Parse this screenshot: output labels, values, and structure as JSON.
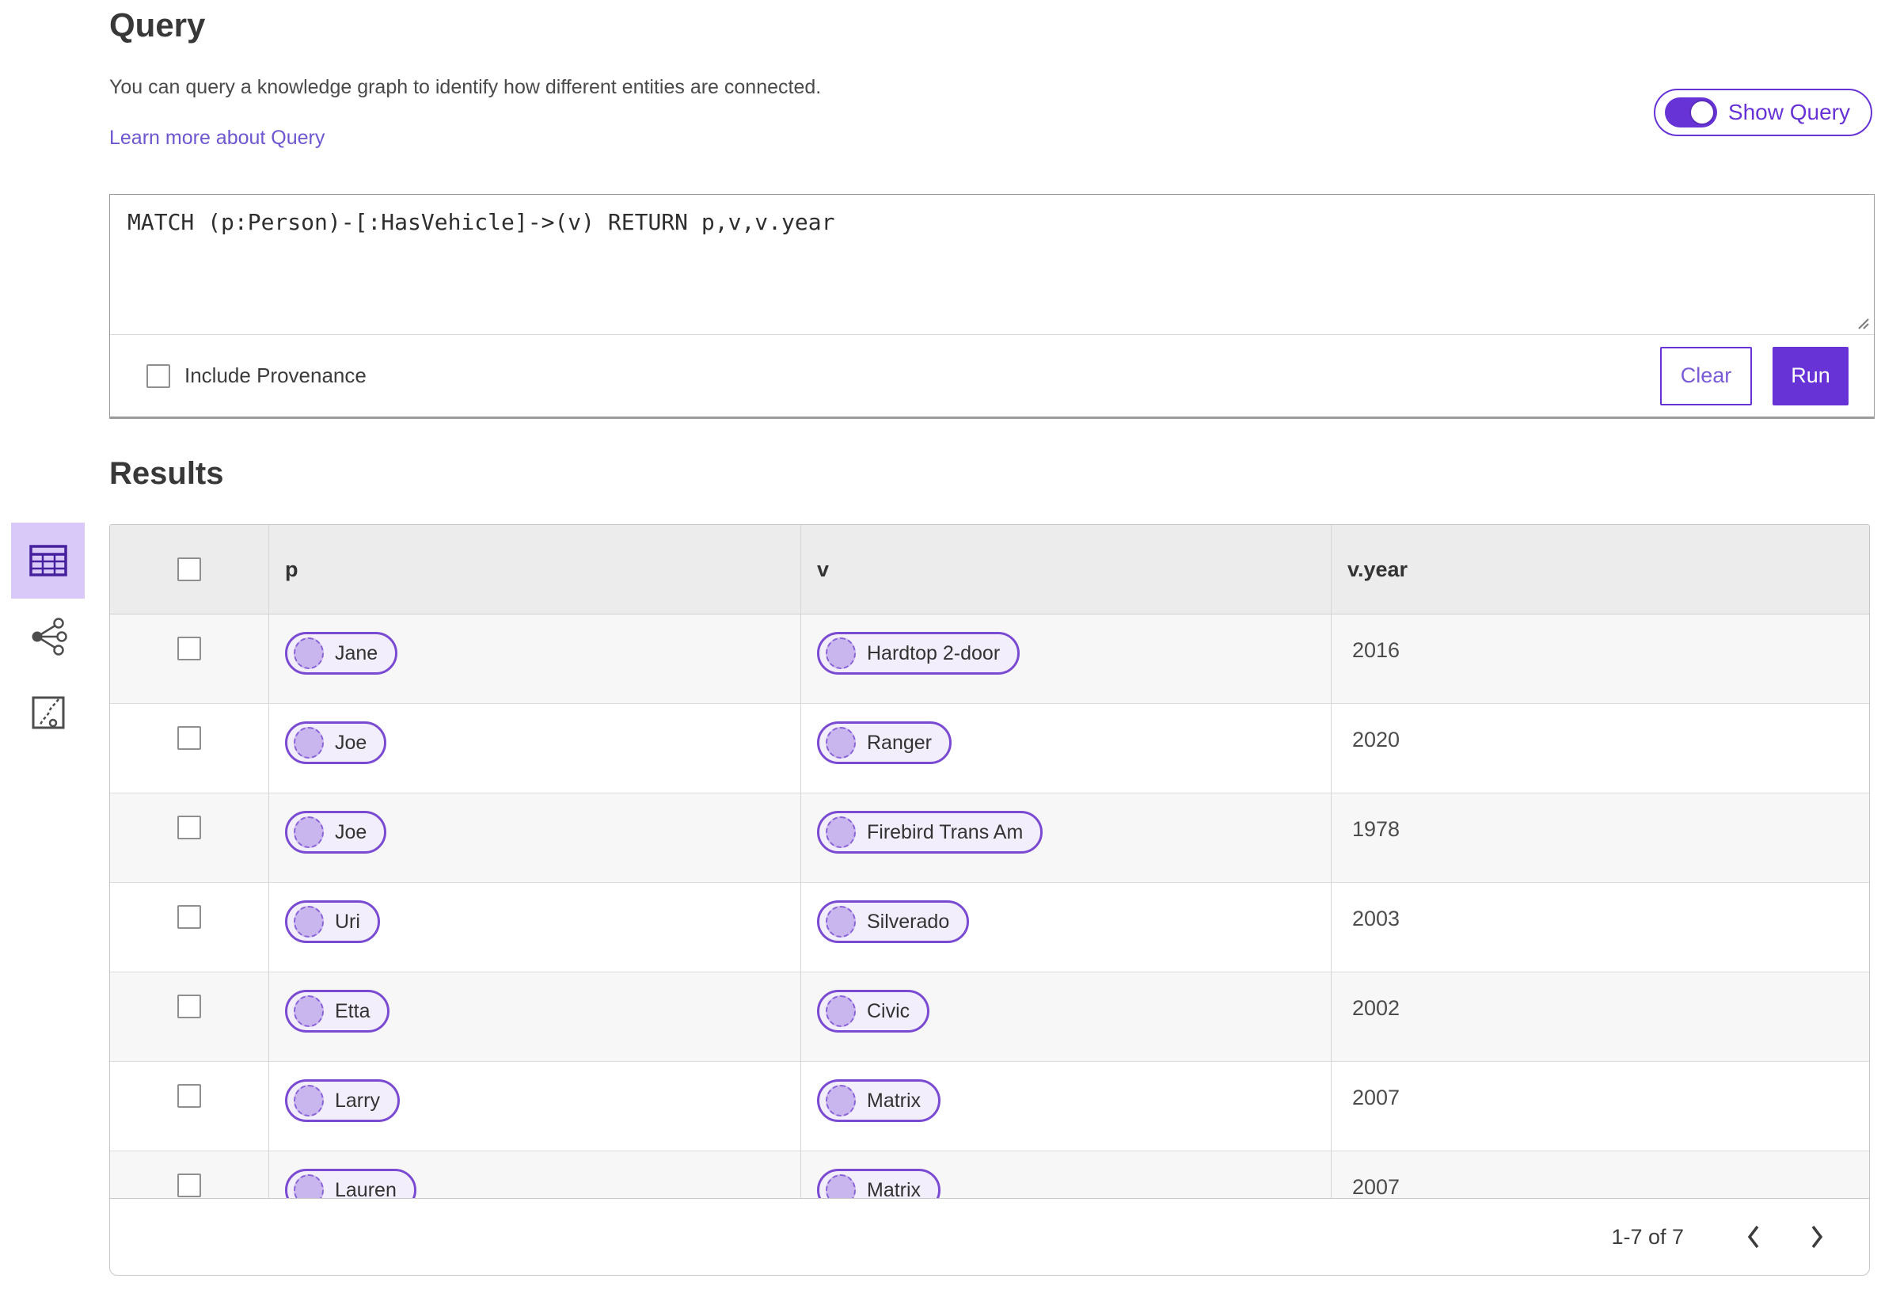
{
  "header": {
    "title": "Query",
    "description": "You can query a knowledge graph to identify how different entities are connected.",
    "learn_more": "Learn more about Query",
    "show_query_label": "Show Query",
    "show_query_on": true
  },
  "query_panel": {
    "query_text": "MATCH (p:Person)-[:HasVehicle]->(v) RETURN p,v,v.year",
    "include_provenance_label": "Include Provenance",
    "include_provenance_checked": false,
    "clear_label": "Clear",
    "run_label": "Run"
  },
  "results": {
    "title": "Results",
    "view_tabs": [
      {
        "name": "table-view",
        "icon": "table-icon",
        "selected": true
      },
      {
        "name": "graph-view",
        "icon": "network-graph-icon",
        "selected": false
      },
      {
        "name": "path-view",
        "icon": "route-map-icon",
        "selected": false
      }
    ],
    "columns": [
      "p",
      "v",
      "v.year"
    ],
    "rows": [
      {
        "p": "Jane",
        "v": "Hardtop 2-door",
        "v_year": "2016"
      },
      {
        "p": "Joe",
        "v": "Ranger",
        "v_year": "2020"
      },
      {
        "p": "Joe",
        "v": "Firebird Trans Am",
        "v_year": "1978"
      },
      {
        "p": "Uri",
        "v": "Silverado",
        "v_year": "2003"
      },
      {
        "p": "Etta",
        "v": "Civic",
        "v_year": "2002"
      },
      {
        "p": "Larry",
        "v": "Matrix",
        "v_year": "2007"
      },
      {
        "p": "Lauren",
        "v": "Matrix",
        "v_year": "2007"
      }
    ],
    "pagination": {
      "range_label": "1-7 of 7"
    }
  },
  "colors": {
    "accent_purple": "#6733d6",
    "link_purple": "#6e56d0",
    "pill_border": "#7a4bd2",
    "pill_background": "#f2eefb",
    "pill_circle_fill": "#c9b6ef",
    "selected_tab_background": "#d9c9f8",
    "table_header_background": "#ececec",
    "row_alt_background": "#f7f7f7"
  }
}
